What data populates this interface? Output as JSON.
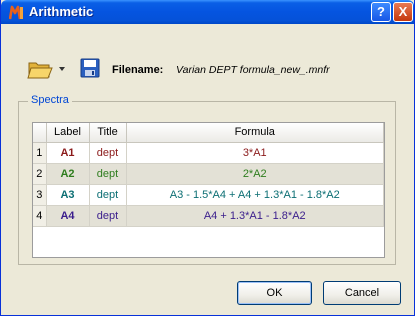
{
  "window": {
    "title": "Arithmetic",
    "help_glyph": "?",
    "close_glyph": "X"
  },
  "toolbar": {
    "open_icon": "folder-icon",
    "save_icon": "floppy-disk-icon",
    "filename_label": "Filename:",
    "filename_value": "Varian DEPT formula_new_.mnfr"
  },
  "spectra": {
    "group_label": "Spectra",
    "columns": [
      "",
      "Label",
      "Title",
      "Formula"
    ],
    "rows": [
      {
        "num": "1",
        "label": "A1",
        "title": "dept",
        "formula": "3*A1",
        "color": "#8b1a1a"
      },
      {
        "num": "2",
        "label": "A2",
        "title": "dept",
        "formula": "2*A2",
        "color": "#2e7d1e"
      },
      {
        "num": "3",
        "label": "A3",
        "title": "dept",
        "formula": "A3 - 1.5*A4 + A4 + 1.3*A1 - 1.8*A2",
        "color": "#0b6e73"
      },
      {
        "num": "4",
        "label": "A4",
        "title": "dept",
        "formula": "A4 + 1.3*A1 - 1.8*A2",
        "color": "#3a1d8c"
      }
    ]
  },
  "buttons": {
    "ok": "OK",
    "cancel": "Cancel"
  }
}
